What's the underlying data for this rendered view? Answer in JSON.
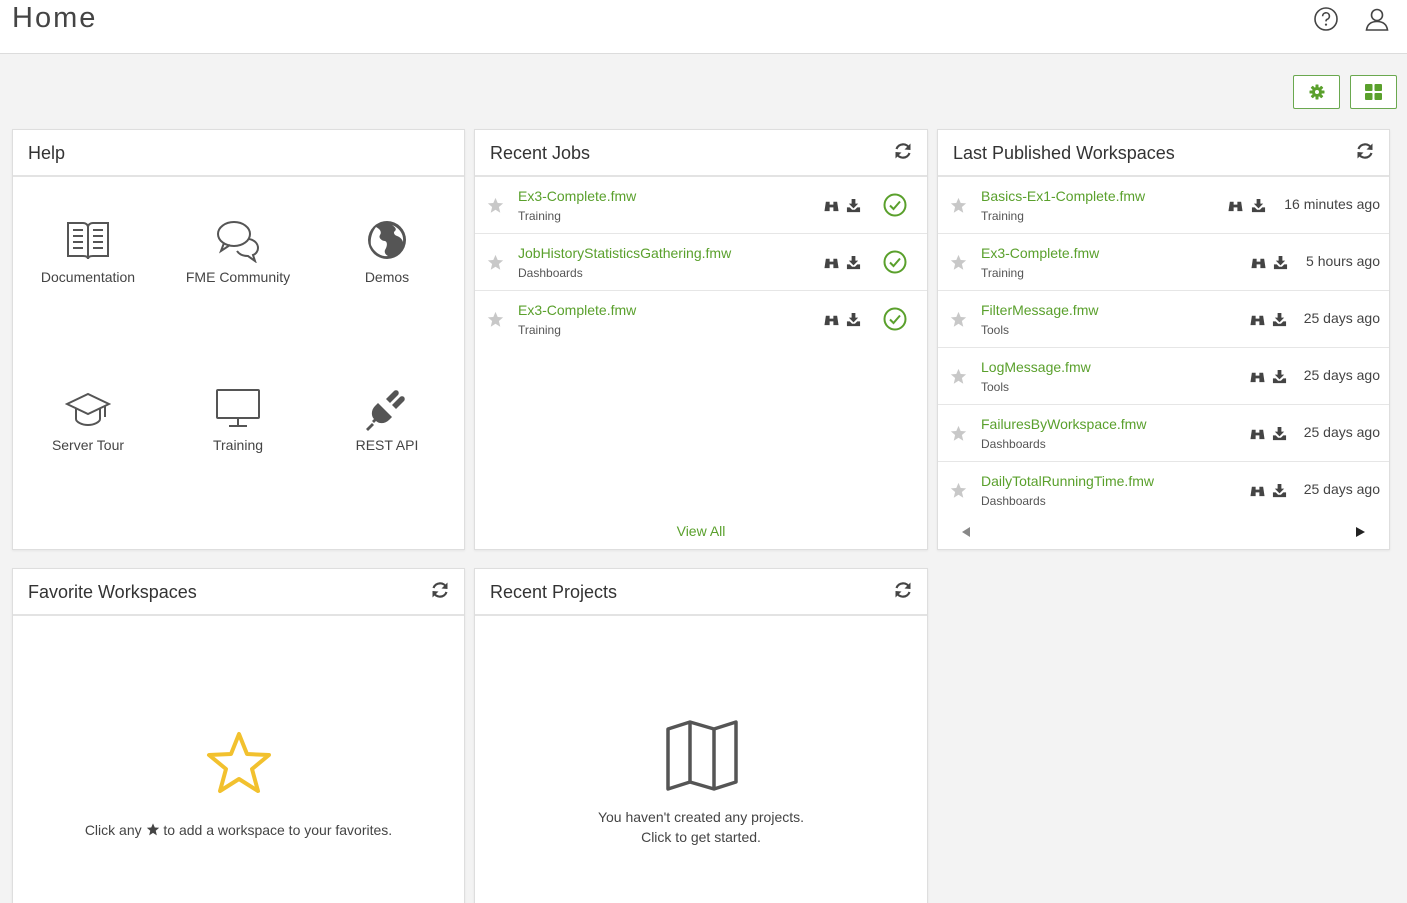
{
  "header": {
    "title": "Home",
    "help_icon": "question-circle-icon",
    "user_icon": "user-icon"
  },
  "toolbar": {
    "settings_icon": "gear-icon",
    "layout_icon": "grid-icon",
    "accent": "#6aa84f"
  },
  "help": {
    "title": "Help",
    "items": [
      {
        "label": "Documentation",
        "icon": "book-icon"
      },
      {
        "label": "FME Community",
        "icon": "chat-bubbles-icon"
      },
      {
        "label": "Demos",
        "icon": "globe-icon"
      },
      {
        "label": "Server Tour",
        "icon": "graduation-cap-icon"
      },
      {
        "label": "Training",
        "icon": "monitor-icon"
      },
      {
        "label": "REST API",
        "icon": "plug-icon"
      }
    ]
  },
  "recent_jobs": {
    "title": "Recent Jobs",
    "view_all": "View All",
    "rows": [
      {
        "name": "Ex3-Complete.fmw",
        "repo": "Training",
        "status": "success"
      },
      {
        "name": "JobHistoryStatisticsGathering.fmw",
        "repo": "Dashboards",
        "status": "success"
      },
      {
        "name": "Ex3-Complete.fmw",
        "repo": "Training",
        "status": "success"
      }
    ]
  },
  "last_published": {
    "title": "Last Published Workspaces",
    "rows": [
      {
        "name": "Basics-Ex1-Complete.fmw",
        "repo": "Training",
        "ago": "16 minutes ago"
      },
      {
        "name": "Ex3-Complete.fmw",
        "repo": "Training",
        "ago": "5 hours ago"
      },
      {
        "name": "FilterMessage.fmw",
        "repo": "Tools",
        "ago": "25 days ago"
      },
      {
        "name": "LogMessage.fmw",
        "repo": "Tools",
        "ago": "25 days ago"
      },
      {
        "name": "FailuresByWorkspace.fmw",
        "repo": "Dashboards",
        "ago": "25 days ago"
      },
      {
        "name": "DailyTotalRunningTime.fmw",
        "repo": "Dashboards",
        "ago": "25 days ago"
      }
    ]
  },
  "favorites": {
    "title": "Favorite Workspaces",
    "hint_before": "Click any",
    "hint_after": "to add a workspace to your favorites."
  },
  "projects": {
    "title": "Recent Projects",
    "empty_line1": "You haven't created any projects.",
    "empty_line2": "Click to get started."
  },
  "colors": {
    "link_green": "#5aa02c",
    "star_yellow": "#f2c12e",
    "check_green": "#5aa02c"
  }
}
